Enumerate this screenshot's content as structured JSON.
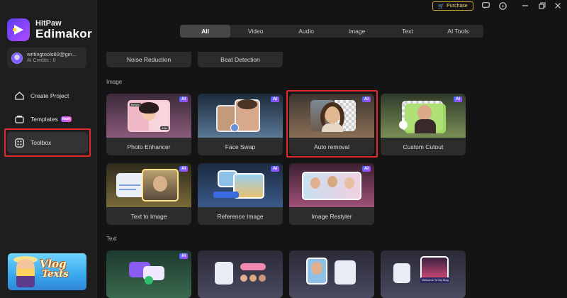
{
  "app": {
    "name_top": "HitPaw",
    "name_bottom": "Edimakor"
  },
  "account": {
    "email": "writingtools60@gm...",
    "credits": "AI Credits : 0"
  },
  "nav": {
    "create_project": "Create Project",
    "templates": "Templates",
    "templates_badge": "New",
    "toolbox": "Toolbox"
  },
  "promo": {
    "line1": "Vlog",
    "line2": "Texts"
  },
  "topbar": {
    "purchase": "Purchase",
    "icons": [
      "feedback-icon",
      "info-icon",
      "minimize-icon",
      "restore-icon",
      "close-icon"
    ]
  },
  "tabs": [
    "All",
    "Video",
    "Audio",
    "Image",
    "Text",
    "AI Tools"
  ],
  "audio_tools": [
    "Noise Reduction",
    "Beat Detection"
  ],
  "sections": {
    "image": "Image",
    "text": "Text"
  },
  "ai_badge": "AI",
  "image_tools": [
    {
      "label": "Photo Enhancer",
      "before": "Before",
      "after": "After"
    },
    {
      "label": "Face Swap"
    },
    {
      "label": "Auto removal"
    },
    {
      "label": "Custom Cutout"
    },
    {
      "label": "Text to Image"
    },
    {
      "label": "Reference Image"
    },
    {
      "label": "Image Restyler"
    }
  ],
  "text_tools": {
    "welcome_text": "Welcome To My Blog"
  },
  "colors": {
    "highlight": "#e12a2a",
    "purchase_gold": "#d7a93f",
    "ai_badge_start": "#3f6bff",
    "ai_badge_end": "#b548ff"
  }
}
